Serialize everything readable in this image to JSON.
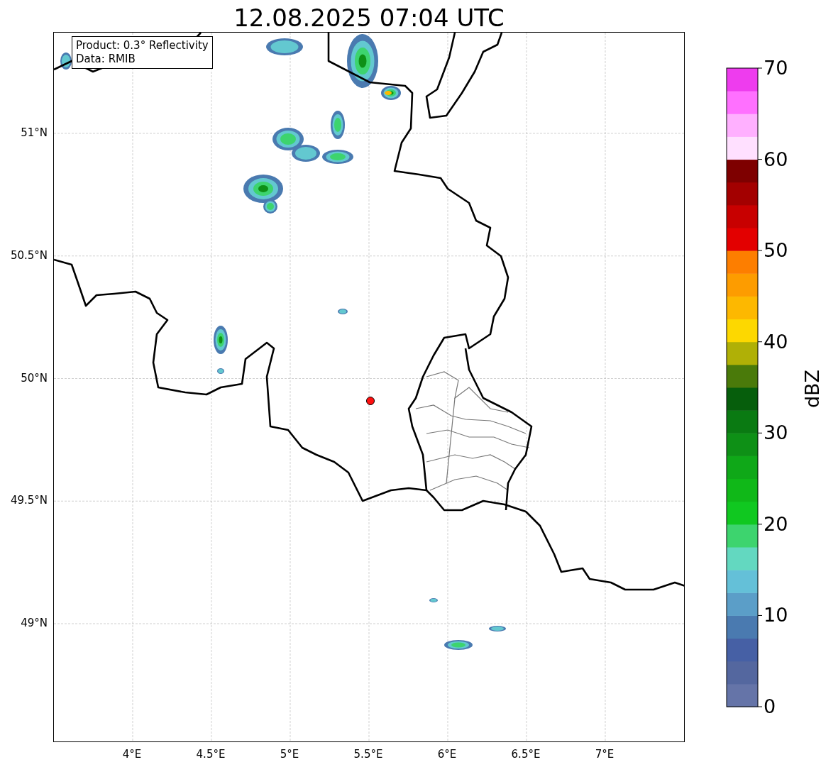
{
  "title": "12.08.2025 07:04 UTC",
  "info_box": [
    "Product: 0.3° Reflectivity",
    "Data: RMIB"
  ],
  "map": {
    "x_ticks": [
      "4°E",
      "4.5°E",
      "5°E",
      "5.5°E",
      "6°E",
      "6.5°E",
      "7°E"
    ],
    "y_ticks": [
      "51°N",
      "50.5°N",
      "50°N",
      "49.5°N",
      "49°N"
    ]
  },
  "colorbar": {
    "label": "dBZ",
    "ticks": [
      "70",
      "60",
      "50",
      "40",
      "30",
      "20",
      "10",
      "0"
    ]
  }
}
